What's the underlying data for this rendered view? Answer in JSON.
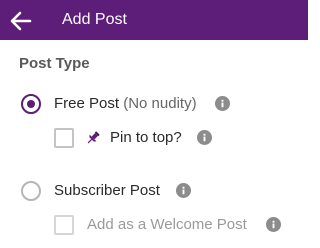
{
  "header": {
    "title": "Add Post",
    "back_icon": "arrow-left-icon",
    "background": "#5c1e78"
  },
  "section": {
    "title": "Post Type"
  },
  "options": {
    "free_post": {
      "label": "Free Post",
      "note": "(No nudity)",
      "selected": true,
      "pin_to_top": {
        "label": "Pin to top?",
        "checked": false,
        "icon": "pin-icon"
      }
    },
    "subscriber_post": {
      "label": "Subscriber Post",
      "selected": false,
      "welcome_post": {
        "label": "Add as a Welcome Post",
        "checked": false,
        "disabled": true
      }
    }
  },
  "colors": {
    "accent": "#5c1e78",
    "info_icon": "#8c8c8c"
  }
}
